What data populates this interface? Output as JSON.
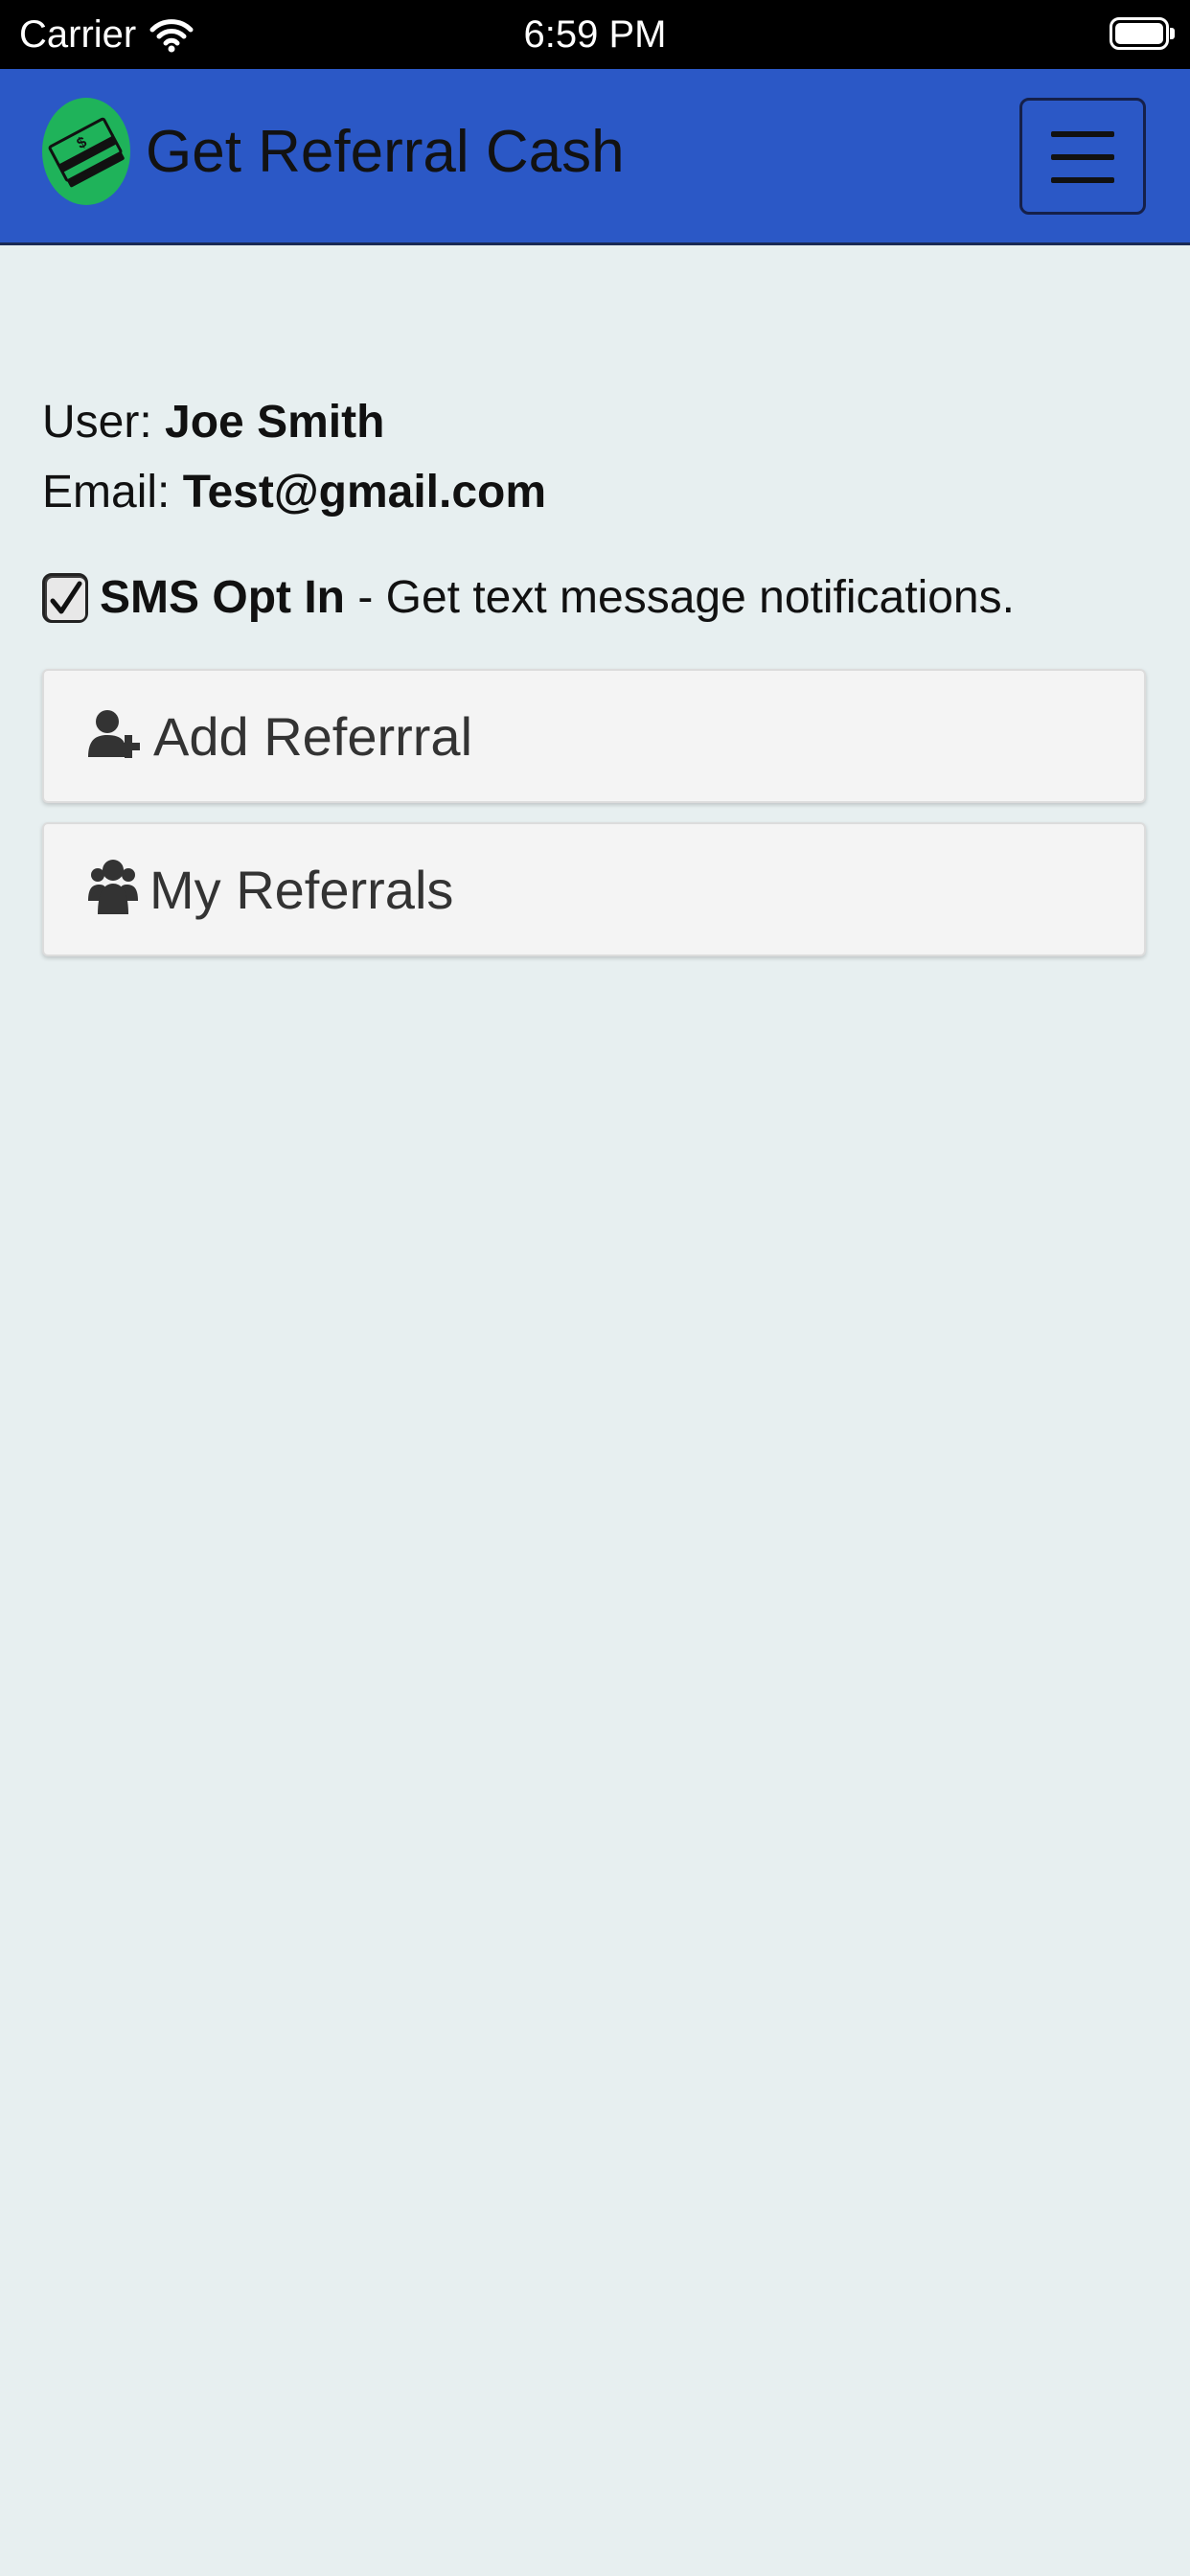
{
  "status_bar": {
    "carrier": "Carrier",
    "time": "6:59 PM",
    "wifi_icon": "wifi-icon",
    "battery_icon": "battery-full-icon"
  },
  "navbar": {
    "brand_title": "Get Referral Cash",
    "logo_icon": "money-stack-icon",
    "menu_icon": "hamburger-menu-icon",
    "background_color": "#2b58c6",
    "logo_color": "#1fb35a"
  },
  "user": {
    "user_label": "User:",
    "user_name": "Joe Smith",
    "email_label": "Email:",
    "email_value": "Test@gmail.com"
  },
  "sms": {
    "checked": true,
    "label_bold": "SMS Opt In",
    "label_rest": " - Get text message notifications."
  },
  "actions": [
    {
      "label": "Add Referrral",
      "icon": "user-plus-icon"
    },
    {
      "label": "My Referrals",
      "icon": "users-icon"
    }
  ]
}
